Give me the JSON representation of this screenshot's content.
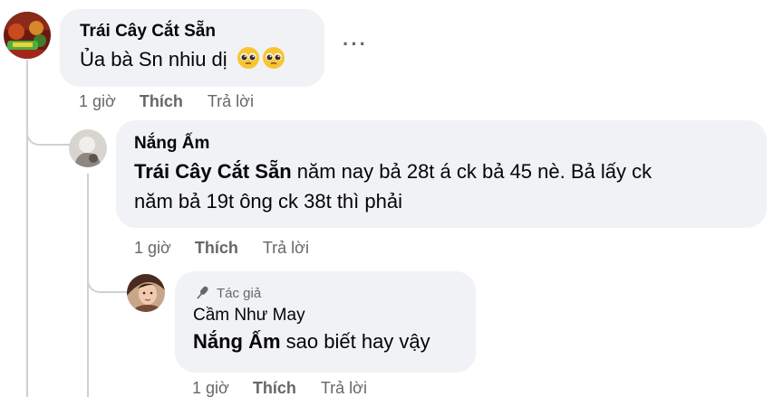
{
  "comments": [
    {
      "author": "Trái Cây Cắt Sẵn",
      "text": "Ủa bà Sn nhiu dị",
      "emoji": "🥺🥺",
      "time": "1 giờ",
      "like": "Thích",
      "reply": "Trả lời"
    },
    {
      "author": "Nắng Ấm",
      "mention": "Trái Cây Cắt Sẵn",
      "text_line1": " năm nay bả 28t á ck bả 45 nè. Bả lấy ck",
      "text_line2": "năm bả 19t ông ck 38t thì phải",
      "time": "1 giờ",
      "like": "Thích",
      "reply": "Trả lời"
    },
    {
      "badge": "Tác giả",
      "author": "Cầm Như May",
      "mention": "Nắng Ấm",
      "text": " sao biết hay vậy",
      "time": "1 giờ",
      "like": "Thích",
      "reply": "Trả lời"
    }
  ],
  "more_label": "···",
  "colors": {
    "bubble": "#f0f2f5",
    "meta": "#65676b",
    "line": "#ced0d4"
  }
}
